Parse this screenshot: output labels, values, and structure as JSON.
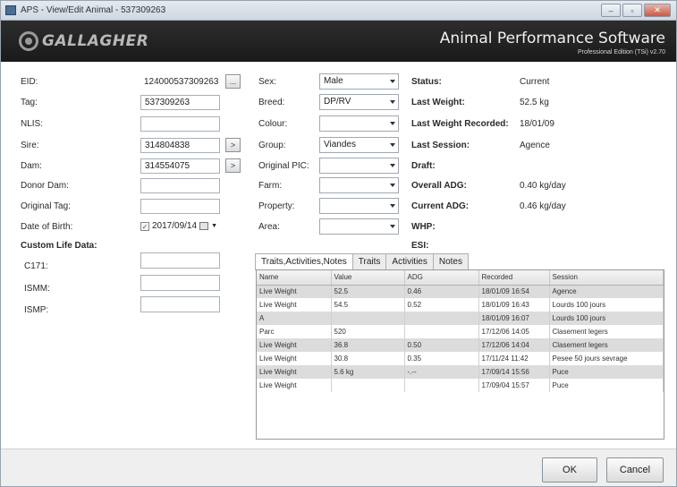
{
  "window": {
    "title": "APS - View/Edit Animal - 537309263",
    "min_glyph": "–",
    "max_glyph": "▫",
    "close_glyph": "✕"
  },
  "banner": {
    "logo_text": "GALLAGHER",
    "app_name": "Animal Performance Software",
    "edition": "Professional Edition (TSi) v2.70"
  },
  "left": {
    "eid_label": "EID:",
    "eid_value": "124000537309263",
    "eid_btn": "...",
    "tag_label": "Tag:",
    "tag_value": "537309263",
    "nlis_label": "NLIS:",
    "nlis_value": "",
    "sire_label": "Sire:",
    "sire_value": "314804838",
    "sire_btn": ">",
    "dam_label": "Dam:",
    "dam_value": "314554075",
    "dam_btn": ">",
    "donor_dam_label": "Donor Dam:",
    "donor_dam_value": "",
    "original_tag_label": "Original Tag:",
    "original_tag_value": "",
    "dob_label": "Date of Birth:",
    "dob_value": "2017/09/14",
    "dob_check": "✓",
    "custom_life_label": "Custom Life Data:",
    "c171_label": "C171:",
    "c171_value": "",
    "ismm_label": "ISMM:",
    "ismm_value": "",
    "ismp_label": "ISMP:",
    "ismp_value": ""
  },
  "middle": {
    "sex_label": "Sex:",
    "sex_value": "Male",
    "breed_label": "Breed:",
    "breed_value": "DP/RV",
    "colour_label": "Colour:",
    "colour_value": "",
    "group_label": "Group:",
    "group_value": "Viandes",
    "original_pic_label": "Original PIC:",
    "original_pic_value": "",
    "farm_label": "Farm:",
    "farm_value": "",
    "property_label": "Property:",
    "property_value": "",
    "area_label": "Area:",
    "area_value": ""
  },
  "right": {
    "status_label": "Status:",
    "status_value": "Current",
    "last_weight_label": "Last Weight:",
    "last_weight_value": "52.5 kg",
    "last_weight_recorded_label": "Last Weight Recorded:",
    "last_weight_recorded_value": "18/01/09",
    "last_session_label": "Last Session:",
    "last_session_value": "Agence",
    "draft_label": "Draft:",
    "overall_adg_label": "Overall ADG:",
    "overall_adg_value": "0.40 kg/day",
    "current_adg_label": "Current ADG:",
    "current_adg_value": "0.46 kg/day",
    "whp_label": "WHP:",
    "esi_label": "ESI:"
  },
  "tabs": [
    {
      "label": "Traits,Activities,Notes"
    },
    {
      "label": "Traits"
    },
    {
      "label": "Activities"
    },
    {
      "label": "Notes"
    }
  ],
  "grid": {
    "columns": [
      "Name",
      "Value",
      "ADG",
      "Recorded",
      "Session"
    ],
    "rows": [
      [
        "Live Weight",
        "52.5",
        "0.46",
        "18/01/09 16:54",
        "Agence"
      ],
      [
        "Live Weight",
        "54.5",
        "0.52",
        "18/01/09 16:43",
        "Lourds 100 jours"
      ],
      [
        "A",
        "",
        "",
        "18/01/09 16:07",
        "Lourds 100 jours"
      ],
      [
        "Parc",
        "520",
        "",
        "17/12/06 14:05",
        "Clasement legers"
      ],
      [
        "Live Weight",
        "36.8",
        "0.50",
        "17/12/06 14:04",
        "Clasement legers"
      ],
      [
        "Live Weight",
        "30.8",
        "0.35",
        "17/11/24 11:42",
        "Pesee 50 jours sevrage"
      ],
      [
        "Live Weight",
        "5.6 kg",
        "-.--",
        "17/09/14 15:56",
        "Puce"
      ],
      [
        "Live Weight",
        "",
        "",
        "17/09/04 15:57",
        "Puce"
      ]
    ]
  },
  "footer": {
    "ok_label": "OK",
    "cancel_label": "Cancel"
  }
}
